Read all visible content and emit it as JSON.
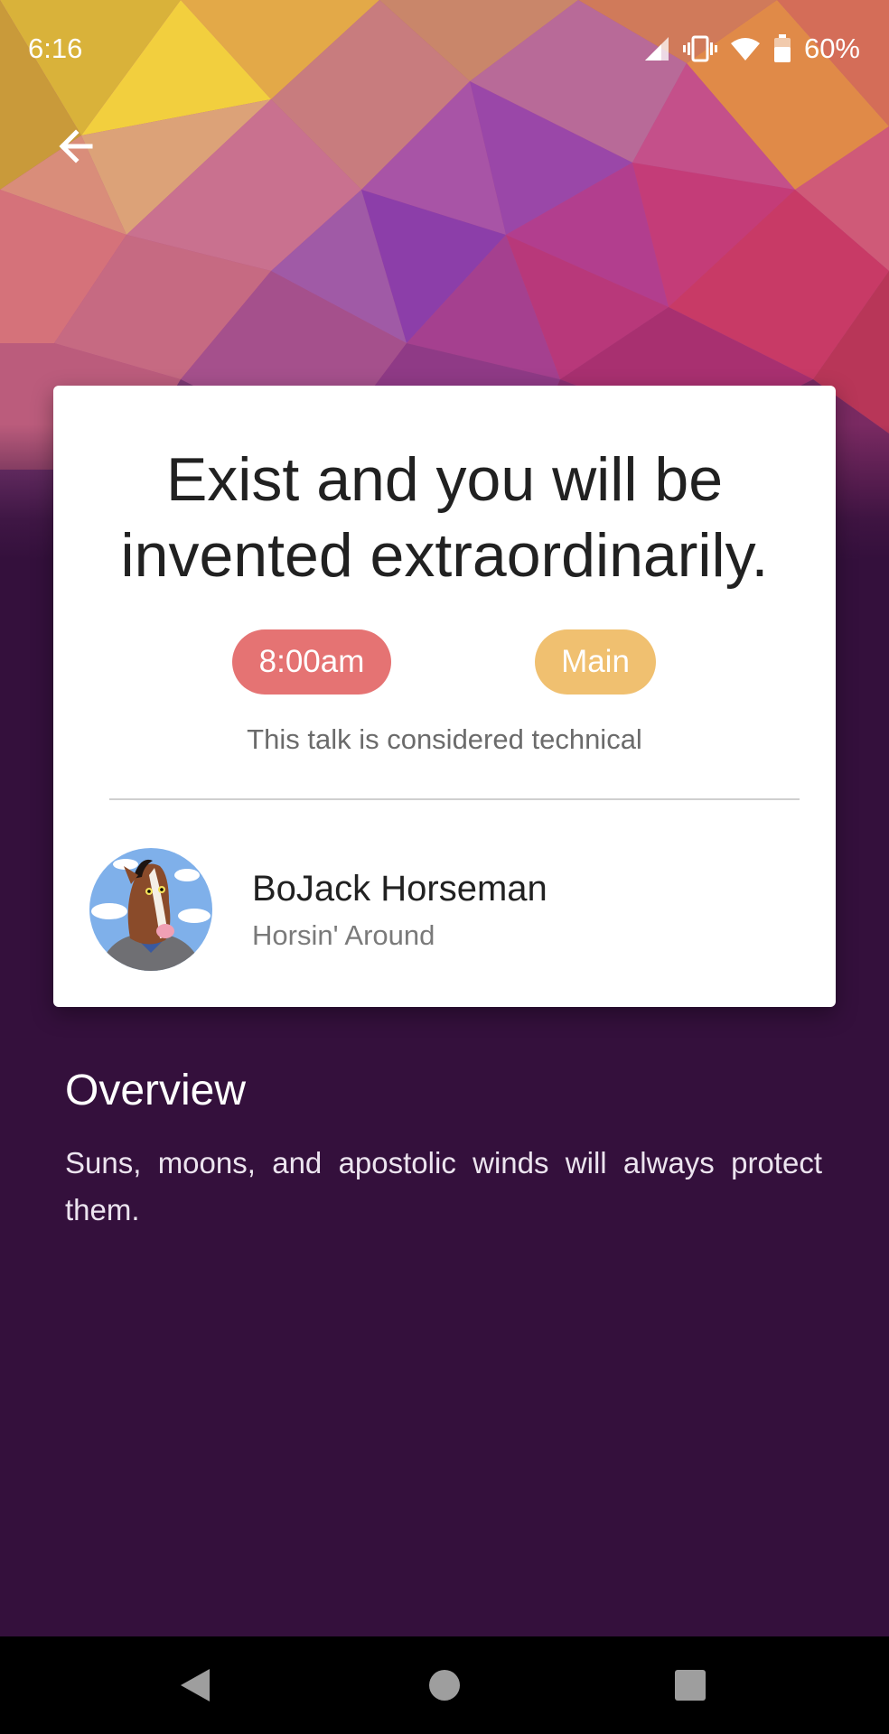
{
  "status_bar": {
    "time": "6:16",
    "battery": "60%",
    "icons": [
      "signal-icon",
      "vibrate-icon",
      "wifi-icon",
      "battery-icon"
    ]
  },
  "header": {
    "back_icon": "arrow-left-icon"
  },
  "talk": {
    "title": "Exist and you will be invented extraordinarily.",
    "time_chip": "8:00am",
    "track_chip": "Main",
    "note": "This talk is considered technical",
    "colors": {
      "time_chip": "#e57373",
      "track_chip": "#f0c070"
    }
  },
  "speaker": {
    "name": "BoJack Horseman",
    "show": "Horsin' Around"
  },
  "overview": {
    "heading": "Overview",
    "body": "Suns, moons, and apostolic winds will always protect them."
  },
  "nav": {
    "icons": [
      "back-triangle-icon",
      "home-circle-icon",
      "recents-square-icon"
    ]
  }
}
